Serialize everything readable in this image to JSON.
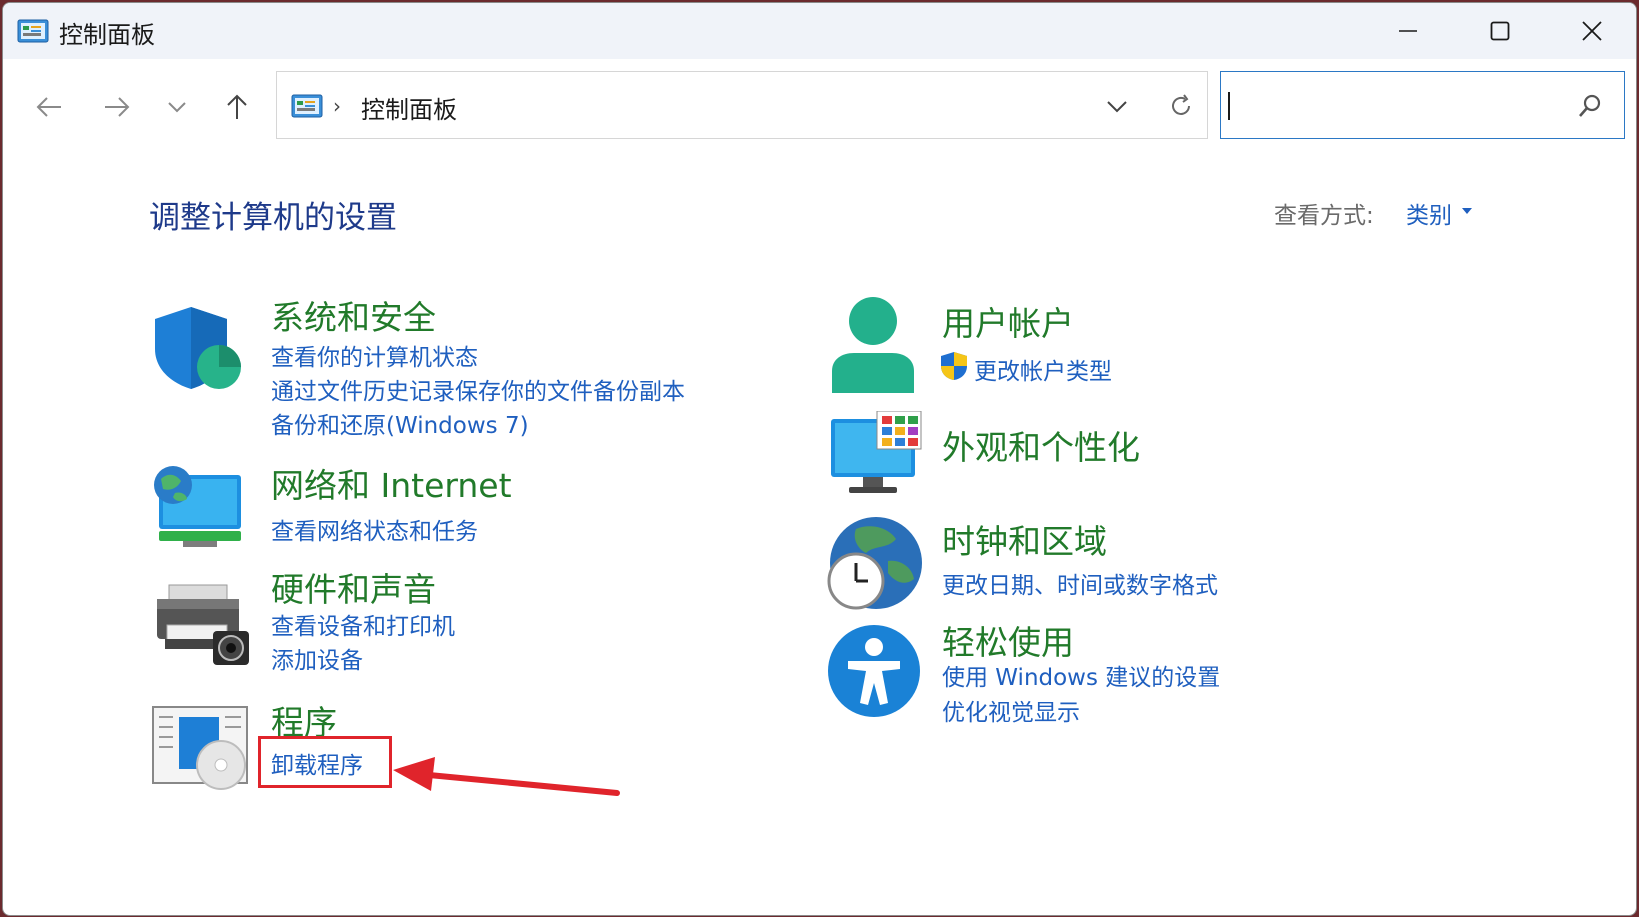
{
  "window": {
    "title": "控制面板",
    "title_icon": "control-panel-icon"
  },
  "nav": {
    "back_icon": "arrow-left-icon",
    "forward_icon": "arrow-right-icon",
    "recent_icon": "chevron-down-icon",
    "up_icon": "arrow-up-icon"
  },
  "address": {
    "path": "控制面板"
  },
  "search": {
    "value": "",
    "placeholder": ""
  },
  "content": {
    "heading": "调整计算机的设置",
    "view_by_label": "查看方式:",
    "view_by_value": "类别"
  },
  "categories_left": [
    {
      "title": "系统和安全",
      "links": [
        "查看你的计算机状态",
        "通过文件历史记录保存你的文件备份副本",
        "备份和还原(Windows 7)"
      ]
    },
    {
      "title": "网络和 Internet",
      "links": [
        "查看网络状态和任务"
      ]
    },
    {
      "title": "硬件和声音",
      "links": [
        "查看设备和打印机",
        "添加设备"
      ]
    },
    {
      "title": "程序",
      "links": [
        "卸载程序"
      ]
    }
  ],
  "categories_right": [
    {
      "title": "用户帐户",
      "links": [
        "更改帐户类型"
      ]
    },
    {
      "title": "外观和个性化",
      "links": []
    },
    {
      "title": "时钟和区域",
      "links": [
        "更改日期、时间或数字格式"
      ]
    },
    {
      "title": "轻松使用",
      "links": [
        "使用 Windows 建议的设置",
        "优化视觉显示"
      ]
    }
  ],
  "colors": {
    "category_title": "#217a2a",
    "link": "#1f5fbf",
    "heading": "#1e3a8a",
    "annotation": "#e0242b"
  }
}
